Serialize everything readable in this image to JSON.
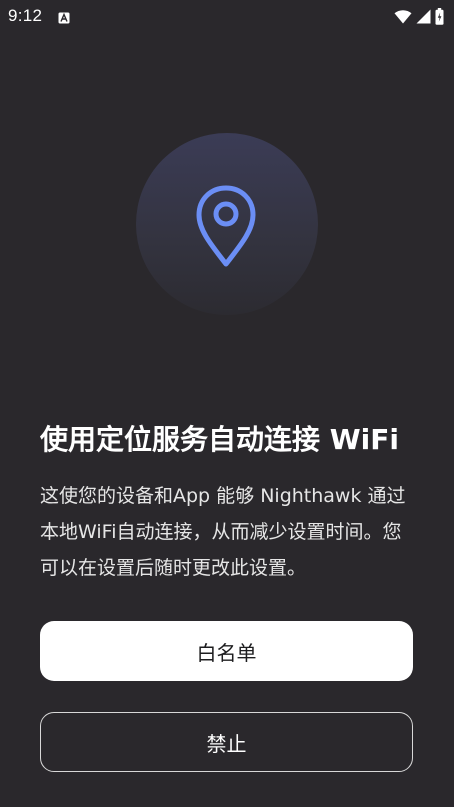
{
  "status_bar": {
    "time": "9:12"
  },
  "main": {
    "title": "使用定位服务自动连接 WiFi",
    "description": "这使您的设备和App 能够 Nighthawk 通过本地WiFi自动连接，从而减少设置时间。您可以在设置后随时更改此设置。"
  },
  "buttons": {
    "whitelist_label": "白名单",
    "deny_label": "禁止"
  },
  "colors": {
    "background": "#2a282c",
    "accent": "#6b8ef5",
    "primary_button": "#ffffff"
  },
  "icons": {
    "hero": "location-pin-icon",
    "status_left": "app-notification-icon",
    "status_right": [
      "wifi-icon",
      "cellular-signal-icon",
      "battery-icon"
    ]
  }
}
